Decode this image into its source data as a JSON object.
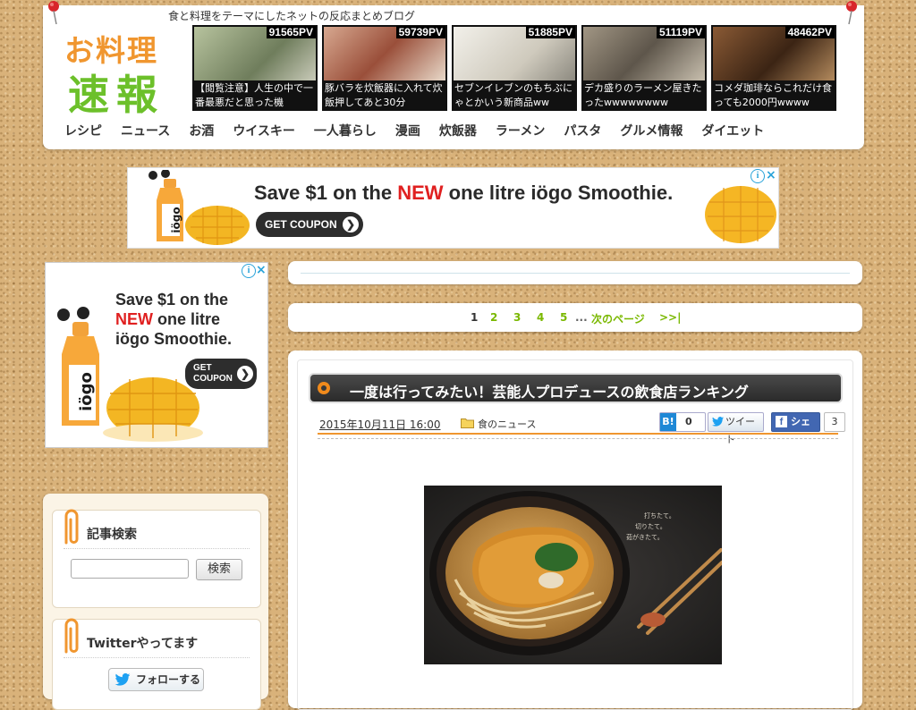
{
  "header": {
    "tagline": "食と料理をテーマにしたネットの反応まとめブログ",
    "logo_line1": "お料理",
    "logo_line2": "速報",
    "thumbs": [
      {
        "pv": "91565PV",
        "caption": "【閲覧注意】人生の中で一番最悪だと思った機",
        "color": "#8c9a7a"
      },
      {
        "pv": "59739PV",
        "caption": "豚バラを炊飯器に入れて炊飯押してあと30分",
        "color": "#a86d55"
      },
      {
        "pv": "51885PV",
        "caption": "セブンイレブンのもちぶにゃとかいう新商品ww",
        "color": "#d8d4c8"
      },
      {
        "pv": "51119PV",
        "caption": "デカ盛りのラーメン屋きたったwwwwwwww",
        "color": "#7d7468"
      },
      {
        "pv": "48462PV",
        "caption": "コメダ珈琲ならこれだけ食っても2000円wwww",
        "color": "#6a4a30"
      }
    ],
    "nav": [
      "レシピ",
      "ニュース",
      "お酒",
      "ウイスキー",
      "一人暮らし",
      "漫画",
      "炊飯器",
      "ラーメン",
      "パスタ",
      "グルメ情報",
      "ダイエット"
    ]
  },
  "banner_ad": {
    "text_before": "Save $1 on the ",
    "text_new": "NEW",
    "text_after": " one litre iögo Smoothie.",
    "coupon": "GET COUPON",
    "info": "i",
    "close": "×"
  },
  "side_ad": {
    "line1": "Save $1 on the",
    "line2_new": "NEW",
    "line2_rest": " one litre",
    "line3": "iögo Smoothie.",
    "coupon1": "GET",
    "coupon2": "COUPON",
    "info": "i",
    "close": "×"
  },
  "sidebar": {
    "search_title": "記事検索",
    "search_button": "検索",
    "twitter_title": "Twitterやってます",
    "follow_button": "フォローする"
  },
  "pager": {
    "pages": [
      "1",
      "2",
      "3",
      "4",
      "5"
    ],
    "ellipsis": "...",
    "next": "次のページ",
    "last": ">>|"
  },
  "article": {
    "title": "一度は行ってみたい！芸能人プロデュースの飲食店ランキング",
    "date": "2015年10月11日 16:00",
    "category": "食のニュース",
    "hatena_label": "B!",
    "hatena_count": "0",
    "tweet": "ツイート",
    "share": "シェア",
    "share_count": "3"
  },
  "colors": {
    "logo_orange": "#f0962f",
    "logo_green": "#6cc02a",
    "link_green": "#7ab800",
    "accent_red": "#e02020"
  }
}
